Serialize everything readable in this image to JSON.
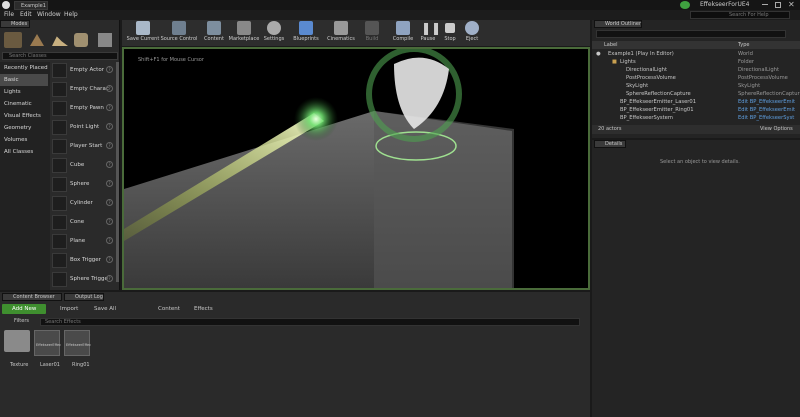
{
  "window": {
    "tab_title": "Example1",
    "project": "EffekseerForUE4",
    "search_help_placeholder": "Search For Help"
  },
  "menu": [
    "File",
    "Edit",
    "Window",
    "Help"
  ],
  "modes": {
    "title": "Modes",
    "search_placeholder": "Search Classes",
    "categories": [
      "Recently Placed",
      "Basic",
      "Lights",
      "Cinematic",
      "Visual Effects",
      "Geometry",
      "Volumes",
      "All Classes"
    ],
    "active_category": "Basic",
    "items": [
      "Empty Actor",
      "Empty Charac",
      "Empty Pawn",
      "Point Light",
      "Player Start",
      "Cube",
      "Sphere",
      "Cylinder",
      "Cone",
      "Plane",
      "Box Trigger",
      "Sphere Trigge"
    ]
  },
  "toolbar": {
    "buttons": [
      "Save Current",
      "Source Control",
      "Content",
      "Marketplace",
      "Settings",
      "Blueprints",
      "Cinematics",
      "Build",
      "Compile",
      "Pause",
      "Stop",
      "Eject"
    ]
  },
  "viewport": {
    "hint": "Shift+F1 for Mouse Cursor"
  },
  "outliner": {
    "title": "World Outliner",
    "search_placeholder": "",
    "col_label": "Label",
    "col_type": "Type",
    "rows": [
      {
        "label": "Example1 (Play In Editor)",
        "type": "World"
      },
      {
        "label": "Lights",
        "type": "Folder"
      },
      {
        "label": "DirectionalLight",
        "type": "DirectionalLight"
      },
      {
        "label": "PostProcessVolume",
        "type": "PostProcessVolume"
      },
      {
        "label": "SkyLight",
        "type": "SkyLight"
      },
      {
        "label": "SphereReflectionCapture",
        "type": "SphereReflectionCaptur"
      },
      {
        "label": "BP_EffekseerEmitter_Laser01",
        "type": "Edit BP_EffekseerEmit"
      },
      {
        "label": "BP_EffekseerEmitter_Ring01",
        "type": "Edit BP_EffekseerEmit"
      },
      {
        "label": "BP_EffekseerSystem",
        "type": "Edit BP_EffekseerSyst"
      }
    ],
    "actor_count": "20 actors",
    "view_options": "View Options"
  },
  "details": {
    "title": "Details",
    "empty_text": "Select an object to view details."
  },
  "content_browser": {
    "tabs": [
      "Content Browser",
      "Output Log"
    ],
    "add_new": "Add New",
    "import": "Import",
    "save_all": "Save All",
    "path": [
      "Content",
      "Effects"
    ],
    "filters": "Filters",
    "search_placeholder": "Search Effects",
    "assets": [
      {
        "name": "Texture",
        "thumb": ""
      },
      {
        "name": "Laser01",
        "thumb": "EffekseerEffec"
      },
      {
        "name": "Ring01",
        "thumb": "EffekseerEffec"
      }
    ]
  },
  "colors": {
    "accent_green": "#3f8f2f",
    "link_blue": "#5f9fe0",
    "viewport_border": "#4a6b3a"
  }
}
